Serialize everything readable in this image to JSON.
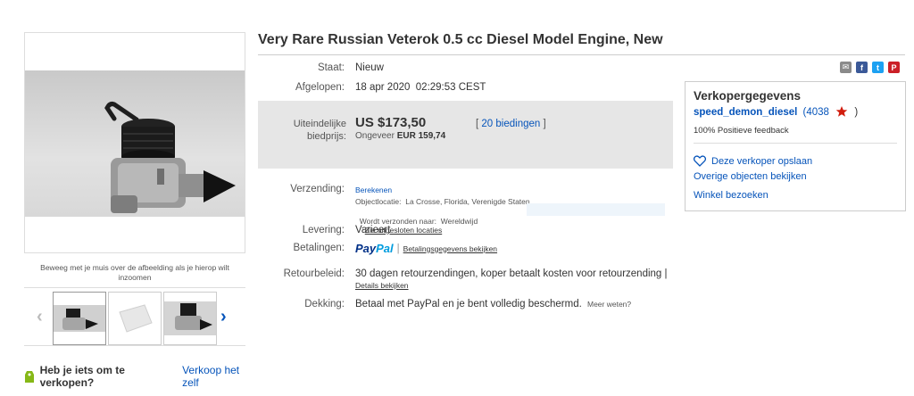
{
  "item": {
    "title": "Very Rare Russian Veterok 0.5 cc Diesel Model Engine, New"
  },
  "gallery": {
    "hover_hint": "Beweeg met je muis over de afbeelding als je hierop wilt inzoomen"
  },
  "sell": {
    "question": "Heb je iets om te verkopen?",
    "link": "Verkoop het zelf"
  },
  "details": {
    "condition_label": "Staat:",
    "condition_value": "Nieuw",
    "ended_label": "Afgelopen:",
    "ended_value": "18 apr 2020  02:29:53 CEST",
    "price_label": "Uiteindelijke biedprijs:",
    "price_value": "US $173,50",
    "price_approx_prefix": "Ongeveer",
    "price_approx_value": "EUR 159,74",
    "bids_prefix": "[",
    "bids_link": "20 biedingen",
    "bids_suffix": "]",
    "shipping_label": "Verzending:",
    "shipping_calc": "Berekenen",
    "object_location": "Objectlocatie:  La Crosse, Florida, Verenigde Staten",
    "ships_to_prefix": "Wordt verzonden naar:  Wereldwijd",
    "ships_exclusions_link": "Zie uitgesloten locaties",
    "delivery_label": "Levering:",
    "delivery_value": "Varieert",
    "payments_label": "Betalingen:",
    "paypal_part1": "Pay",
    "paypal_part2": "Pal",
    "payment_details_link": "Betalingsgegevens bekijken",
    "returns_label": "Retourbeleid:",
    "returns_value": "30 dagen retourzendingen, koper betaalt kosten voor retourzending |",
    "returns_details_link": "Details bekijken",
    "coverage_label": "Dekking:",
    "coverage_value": "Betaal met PayPal en je bent volledig beschermd.",
    "coverage_more_link": "Meer weten?"
  },
  "share": {
    "icons": [
      "email-icon",
      "facebook-icon",
      "twitter-icon",
      "pinterest-icon"
    ],
    "colors": [
      "#8a8a8a",
      "#3b5998",
      "#1da1f2",
      "#cb2027"
    ]
  },
  "seller": {
    "heading": "Verkopergegevens",
    "username": "speed_demon_diesel",
    "feedback_score_open": "(4038",
    "feedback_score_close": ")",
    "positive_feedback": "100% Positieve feedback",
    "save_seller": "Deze verkoper opslaan",
    "other_items": "Overige objecten bekijken",
    "visit_store": "Winkel bezoeken",
    "star_color": "#d11d0e"
  }
}
